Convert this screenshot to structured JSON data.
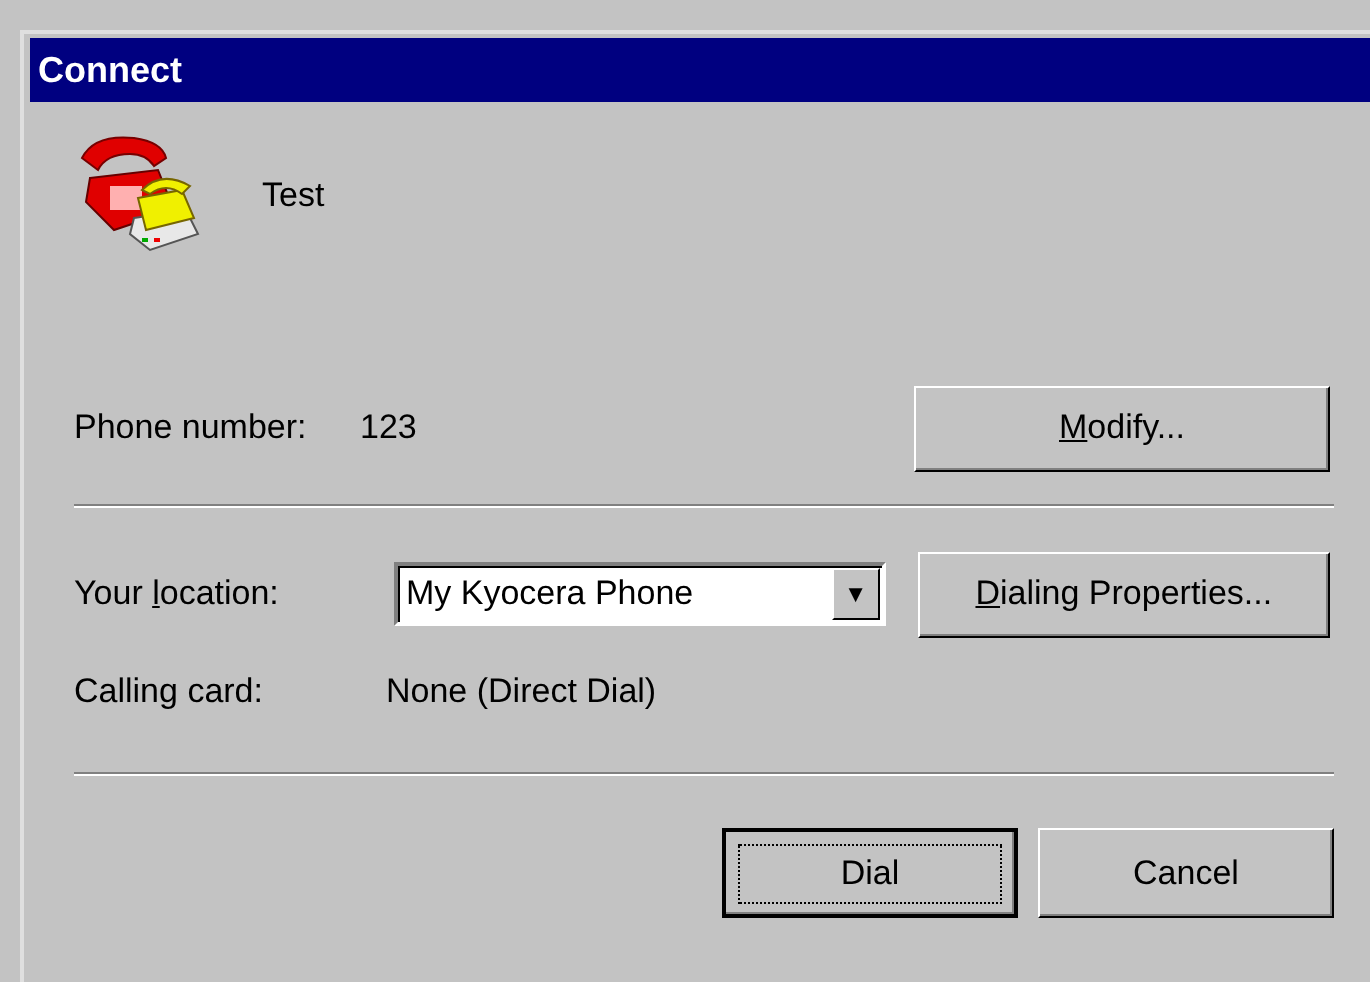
{
  "window": {
    "title": "Connect"
  },
  "connection": {
    "name": "Test"
  },
  "phone": {
    "label": "Phone number:",
    "value": "123",
    "button": {
      "key": "M",
      "after": "odify..."
    }
  },
  "location": {
    "label": {
      "before": "Your ",
      "key": "l",
      "after": "ocation:"
    },
    "value": "My Kyocera Phone",
    "arrow": "▼",
    "button": {
      "key": "D",
      "after": "ialing Properties..."
    }
  },
  "calling_card": {
    "label": "Calling card:",
    "value": "None (Direct Dial)"
  },
  "buttons": [
    {
      "label": "Dial",
      "default": true
    },
    {
      "label": "Cancel",
      "default": false
    }
  ]
}
